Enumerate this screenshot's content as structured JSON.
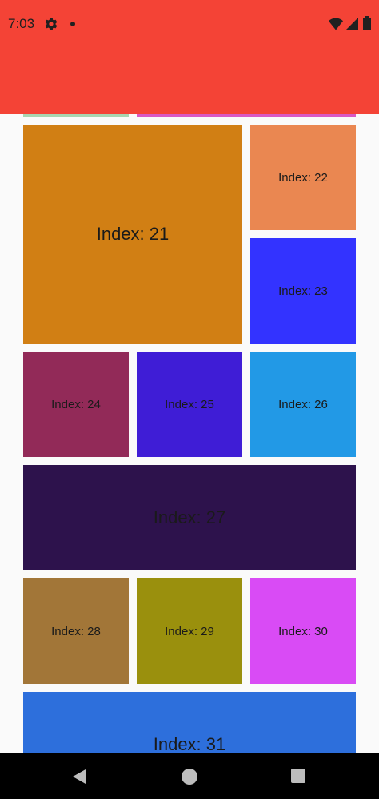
{
  "status_bar": {
    "time": "7:03"
  },
  "tiles": [
    {
      "label": "Index: 21",
      "color": "#D17F14"
    },
    {
      "label": "Index: 22",
      "color": "#EA8751"
    },
    {
      "label": "Index: 23",
      "color": "#3333FF"
    },
    {
      "label": "Index: 24",
      "color": "#922A58"
    },
    {
      "label": "Index: 25",
      "color": "#3F1DD6"
    },
    {
      "label": "Index: 26",
      "color": "#2299E6"
    },
    {
      "label": "Index: 27",
      "color": "#2D124C"
    },
    {
      "label": "Index: 28",
      "color": "#A27638"
    },
    {
      "label": "Index: 29",
      "color": "#9A900D"
    },
    {
      "label": "Index: 30",
      "color": "#D94BF5"
    },
    {
      "label": "Index: 31",
      "color": "#2D6FDC"
    }
  ],
  "partial_tiles_top": [
    {
      "color": "#A8D5B0"
    },
    {
      "color": "#D958C4"
    }
  ],
  "colors": {
    "app_bar": "#F44336",
    "background": "#FAFAFA",
    "nav_bar": "#000000"
  }
}
